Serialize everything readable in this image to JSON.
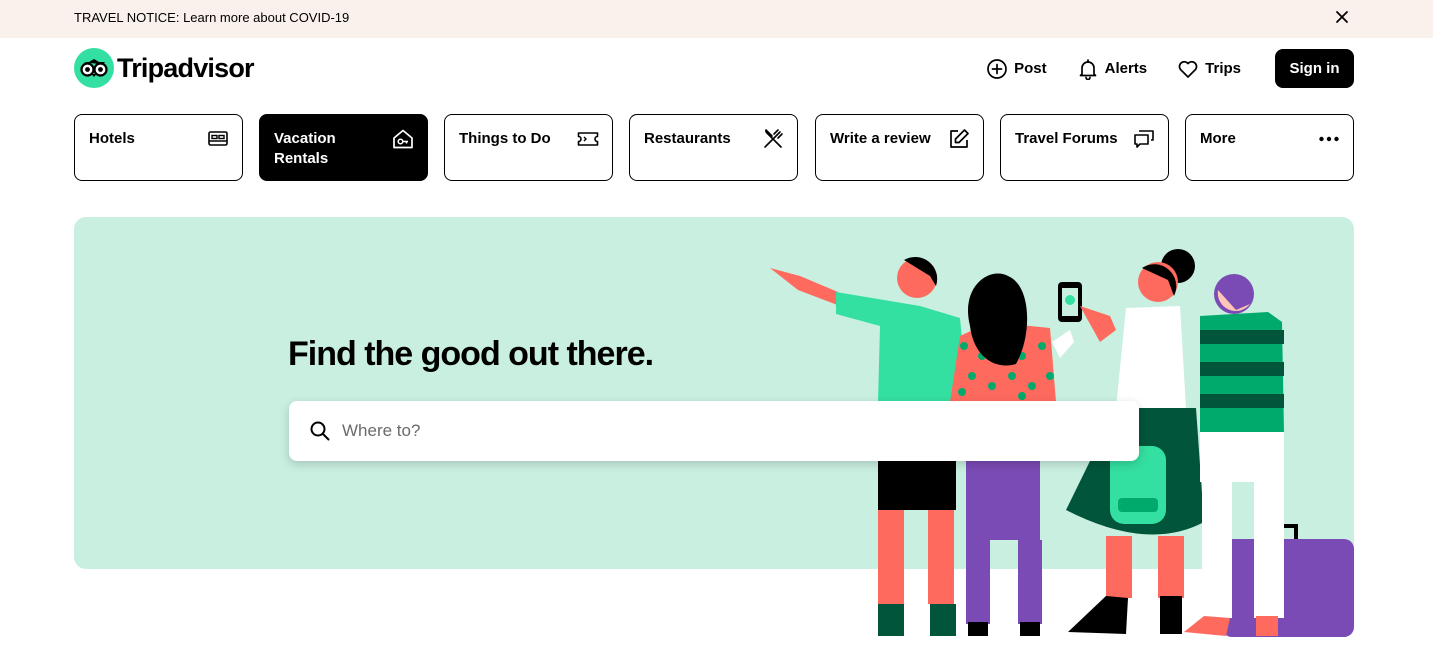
{
  "notice": {
    "text": "TRAVEL NOTICE: Learn more about COVID-19",
    "close_icon": "close-icon"
  },
  "brand": {
    "name": "Tripadvisor",
    "accent": "#34e0a1",
    "logo_icon": "owl-eyes-icon"
  },
  "header": {
    "post_label": "Post",
    "alerts_label": "Alerts",
    "trips_label": "Trips",
    "signin_label": "Sign in"
  },
  "categories": [
    {
      "label": "Hotels",
      "icon": "bed-icon",
      "active": false
    },
    {
      "label": "Vacation Rentals",
      "icon": "house-key-icon",
      "active": true
    },
    {
      "label": "Things to Do",
      "icon": "ticket-icon",
      "active": false
    },
    {
      "label": "Restaurants",
      "icon": "utensils-icon",
      "active": false
    },
    {
      "label": "Write a review",
      "icon": "edit-icon",
      "active": false
    },
    {
      "label": "Travel Forums",
      "icon": "chat-bubbles-icon",
      "active": false
    },
    {
      "label": "More",
      "icon": "more-dots-icon",
      "active": false
    }
  ],
  "hero": {
    "title": "Find the good out there.",
    "search_placeholder": "Where to?",
    "background": "#c9efe0"
  }
}
